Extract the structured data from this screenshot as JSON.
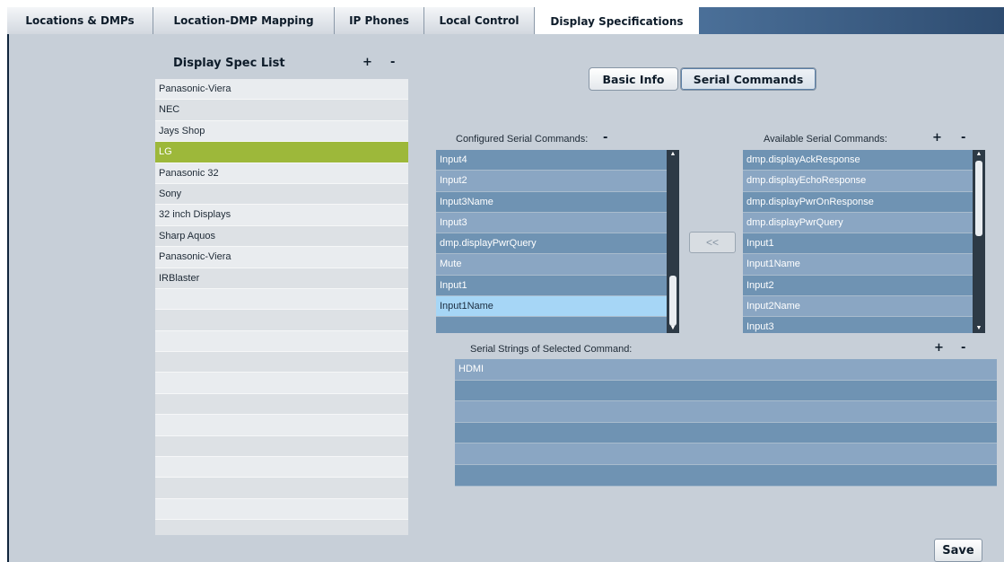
{
  "tabs": [
    {
      "label": "Locations & DMPs",
      "active": false
    },
    {
      "label": "Location-DMP Mapping",
      "active": false
    },
    {
      "label": "IP Phones",
      "active": false
    },
    {
      "label": "Local Control",
      "active": false
    },
    {
      "label": "Display Specifications",
      "active": true
    }
  ],
  "display_spec_list": {
    "title": "Display Spec List",
    "add_label": "+",
    "remove_label": "-",
    "items": [
      "Panasonic-Viera",
      "NEC",
      "Jays Shop",
      "LG",
      "Panasonic 32",
      "Sony",
      "32 inch Displays",
      "Sharp Aquos",
      "Panasonic-Viera",
      "IRBlaster"
    ],
    "selected": "LG"
  },
  "view_toggle": {
    "basic_info_label": "Basic Info",
    "serial_commands_label": "Serial Commands",
    "selected": "Serial Commands"
  },
  "configured": {
    "title": "Configured Serial Commands:",
    "remove_label": "-",
    "items": [
      "Input4",
      "Input2",
      "Input3Name",
      "Input3",
      "dmp.displayPwrQuery",
      "Mute",
      "Input1",
      "Input1Name"
    ],
    "selected": "Input1Name"
  },
  "move_button_label": "<<",
  "available": {
    "title": "Available Serial Commands:",
    "add_label": "+",
    "remove_label": "-",
    "items": [
      "dmp.displayAckResponse",
      "dmp.displayEchoResponse",
      "dmp.displayPwrOnResponse",
      "dmp.displayPwrQuery",
      "Input1",
      "Input1Name",
      "Input2",
      "Input2Name",
      "Input3"
    ]
  },
  "serial_strings": {
    "title": "Serial Strings of Selected Command:",
    "add_label": "+",
    "remove_label": "-",
    "items": [
      "HDMI"
    ]
  },
  "save_label": "Save"
}
